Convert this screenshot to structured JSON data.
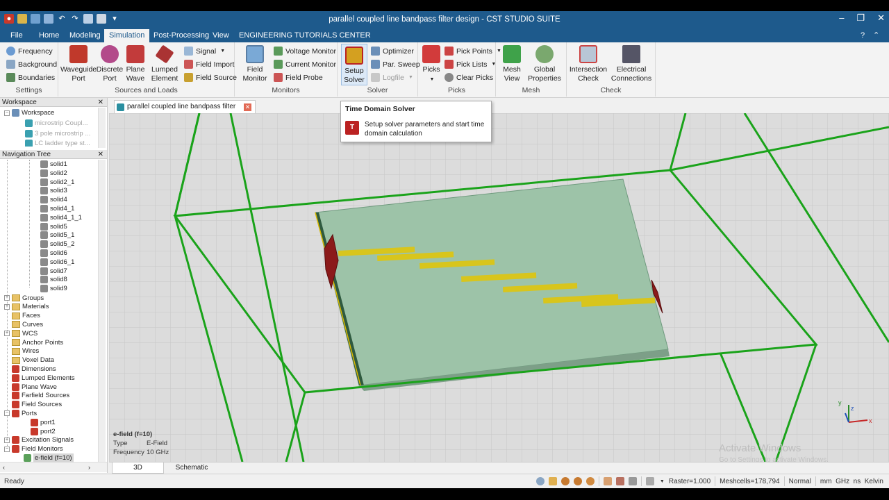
{
  "window": {
    "title": "parallel coupled line bandpass filter design - CST STUDIO SUITE"
  },
  "ribbon_tabs": [
    "File",
    "Home",
    "Modeling",
    "Simulation",
    "Post-Processing",
    "View",
    "ENGINEERING TUTORIALS CENTER"
  ],
  "active_tab": "Simulation",
  "settings": {
    "frequency": "Frequency",
    "background": "Background",
    "boundaries": "Boundaries",
    "group": "Settings"
  },
  "sources": {
    "waveguide_port": "Waveguide\nPort",
    "discrete_port": "Discrete\nPort",
    "plane_wave": "Plane\nWave",
    "lumped_element": "Lumped\nElement",
    "signal": "Signal",
    "field_import": "Field Import",
    "field_source": "Field Source",
    "group": "Sources and Loads"
  },
  "monitors": {
    "field_monitor": "Field\nMonitor",
    "voltage_monitor": "Voltage Monitor",
    "current_monitor": "Current Monitor",
    "field_probe": "Field Probe",
    "group": "Monitors"
  },
  "solver": {
    "setup_solver": "Setup\nSolver",
    "optimizer": "Optimizer",
    "par_sweep": "Par. Sweep",
    "logfile": "Logfile",
    "group": "Solver"
  },
  "picks": {
    "picks": "Picks",
    "pick_points": "Pick Points",
    "pick_lists": "Pick Lists",
    "clear_picks": "Clear Picks",
    "group": "Picks"
  },
  "mesh": {
    "mesh_view": "Mesh\nView",
    "global_properties": "Global\nProperties",
    "group": "Mesh"
  },
  "check": {
    "intersection_check": "Intersection\nCheck",
    "electrical_connections": "Electrical\nConnections",
    "group": "Check"
  },
  "tooltip": {
    "title": "Time Domain Solver",
    "description": "Setup solver parameters and start time domain calculation"
  },
  "workspace": {
    "header": "Workspace",
    "root": "Workspace",
    "items": [
      "microstrip Coupl...",
      "3 pole microstrip ...",
      "LC ladder type st..."
    ]
  },
  "nav": {
    "header": "Navigation Tree",
    "solids": [
      "solid1",
      "solid2",
      "solid2_1",
      "solid3",
      "solid4",
      "solid4_1",
      "solid4_1_1",
      "solid5",
      "solid5_1",
      "solid5_2",
      "solid6",
      "solid6_1",
      "solid7",
      "solid8",
      "solid9"
    ],
    "folders": [
      "Groups",
      "Materials",
      "Faces",
      "Curves",
      "WCS",
      "Anchor Points",
      "Wires",
      "Voxel Data",
      "Dimensions",
      "Lumped Elements",
      "Plane Wave",
      "Farfield Sources",
      "Field Sources",
      "Ports"
    ],
    "ports": [
      "port1",
      "port2"
    ],
    "folders2": [
      "Excitation Signals",
      "Field Monitors"
    ],
    "monitor_item": "e-field (f=10)"
  },
  "document_tab": "parallel coupled line bandpass filter design",
  "info": {
    "title": "e-field (f=10)",
    "type_label": "Type",
    "type_value": "E-Field",
    "freq_label": "Frequency",
    "freq_value": "10 GHz"
  },
  "watermark": {
    "line1": "Activate Windows",
    "line2": "Go to Settings to activate Windows."
  },
  "view_tabs": [
    "3D",
    "Schematic"
  ],
  "status": {
    "text": "Ready",
    "raster": "Raster=1.000",
    "meshcells": "Meshcells=178,794",
    "mode": "Normal",
    "units": "mm  GHz  ns  Kelvin"
  },
  "colors": {
    "titlebar": "#1e5a8c",
    "substrate": "#9dc3a8",
    "strip": "#d8c51c",
    "port": "#8b1a1a",
    "boundary": "#1aa31a"
  }
}
